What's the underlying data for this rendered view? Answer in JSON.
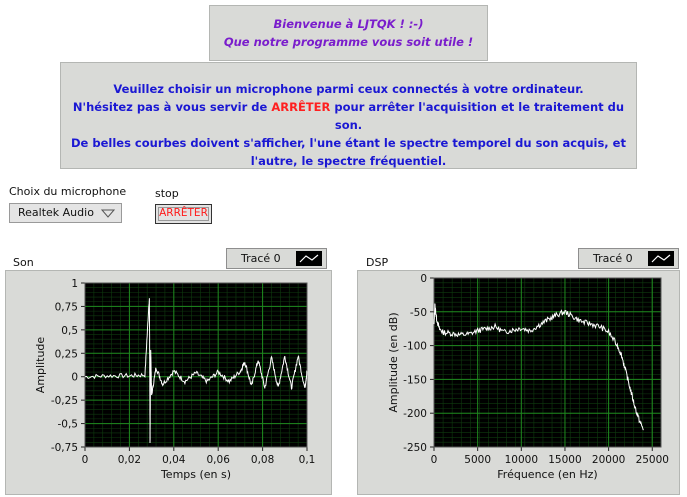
{
  "welcome": {
    "line1": "Bienvenue à LJTQK ! :-)",
    "line2": "Que notre programme vous soit utile !"
  },
  "instructions": {
    "line1": "Veuillez choisir un microphone parmi ceux connectés à votre ordinateur.",
    "line2_prefix": "N'hésitez pas à vous servir de ",
    "line2_highlight": "ARRÊTER",
    "line2_suffix": " pour arrêter l'acquisition et le traitement du son.",
    "line3": "De belles courbes doivent s'afficher, l'une étant le spectre temporel du son acquis, et",
    "line4": "l'autre, le spectre fréquentiel."
  },
  "controls": {
    "mic_label": "Choix du microphone",
    "mic_value": "Realtek Audio",
    "stop_label": "stop",
    "stop_button": "ARRÊTER"
  },
  "colors": {
    "welcome_text": "#7a1dcc",
    "instructions_text": "#1b18d3",
    "highlight": "#ff1f1f",
    "plot_bg": "#000000",
    "grid": "#1f8a1f",
    "trace": "#ffffff"
  },
  "chart_data": [
    {
      "type": "line",
      "title": "Son",
      "legend": "Tracé 0",
      "xlabel": "Temps (en s)",
      "ylabel": "Amplitude",
      "xlim": [
        0,
        0.1
      ],
      "ylim": [
        -0.75,
        1
      ],
      "xticks": [
        "0",
        "0,02",
        "0,04",
        "0,06",
        "0,08",
        "0,1"
      ],
      "yticks": [
        "1",
        "0,75",
        "0,5",
        "0,25",
        "0",
        "-0,25",
        "-0,5",
        "-0,75"
      ],
      "grid": true,
      "series": [
        {
          "x": [
            0,
            0.01,
            0.02,
            0.027,
            0.029,
            0.0293,
            0.0296,
            0.03,
            0.032,
            0.035,
            0.04,
            0.045,
            0.05,
            0.055,
            0.06,
            0.065,
            0.07,
            0.072,
            0.075,
            0.078,
            0.081,
            0.084,
            0.087,
            0.09,
            0.093,
            0.096,
            0.099,
            0.1
          ],
          "y": [
            0,
            0.01,
            0.01,
            0.02,
            0.86,
            -0.72,
            0.3,
            -0.2,
            0.1,
            -0.08,
            0.06,
            -0.05,
            0.04,
            -0.05,
            0.05,
            -0.05,
            0.06,
            0.16,
            -0.1,
            0.18,
            -0.12,
            0.2,
            -0.12,
            0.22,
            -0.12,
            0.22,
            -0.12,
            0.05
          ]
        }
      ]
    },
    {
      "type": "line",
      "title": "DSP",
      "legend": "Tracé 0",
      "xlabel": "Fréquence (en Hz)",
      "ylabel": "Amplitude (en dB)",
      "xlim": [
        0,
        26000
      ],
      "ylim": [
        -250,
        0
      ],
      "xticks": [
        "0",
        "5000",
        "10000",
        "15000",
        "20000",
        "25000"
      ],
      "yticks": [
        "0",
        "-50",
        "-100",
        "-150",
        "-200",
        "-250"
      ],
      "grid": true,
      "series": [
        {
          "x": [
            0,
            100,
            300,
            600,
            1000,
            2000,
            3000,
            4000,
            5000,
            6000,
            7000,
            8000,
            9000,
            10000,
            11000,
            12000,
            13000,
            14000,
            15000,
            16000,
            17000,
            18000,
            19000,
            20000,
            21000,
            21500,
            22000,
            22500,
            23000,
            23500,
            24000
          ],
          "y": [
            -70,
            -40,
            -60,
            -75,
            -80,
            -82,
            -84,
            -83,
            -78,
            -75,
            -72,
            -80,
            -77,
            -74,
            -78,
            -70,
            -62,
            -55,
            -50,
            -58,
            -65,
            -68,
            -72,
            -80,
            -100,
            -115,
            -140,
            -165,
            -190,
            -210,
            -225
          ]
        }
      ]
    }
  ]
}
